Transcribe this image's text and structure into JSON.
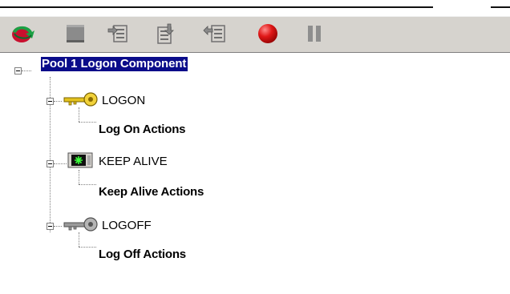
{
  "toolbar": {
    "buttons": [
      {
        "icon": "refresh-green-arrow-icon"
      },
      {
        "icon": "stop-square-icon"
      },
      {
        "icon": "step-icon-1"
      },
      {
        "icon": "step-icon-2"
      },
      {
        "icon": "step-icon-3"
      },
      {
        "icon": "record-red-circle-icon"
      },
      {
        "icon": "pause-icon"
      }
    ]
  },
  "tree": {
    "root": {
      "label": "Pool 1 Logon Component"
    },
    "nodes": [
      {
        "label": "LOGON",
        "icon": "key-yellow-icon",
        "child": {
          "label": "Log On Actions"
        }
      },
      {
        "label": "KEEP ALIVE",
        "icon": "monitor-green-icon",
        "child": {
          "label": "Keep Alive Actions"
        }
      },
      {
        "label": "LOGOFF",
        "icon": "key-gray-icon",
        "child": {
          "label": "Log Off Actions"
        }
      }
    ]
  },
  "colors": {
    "toolbar_bg": "#d6d3ce",
    "selection_bg": "#0a0c8a"
  }
}
